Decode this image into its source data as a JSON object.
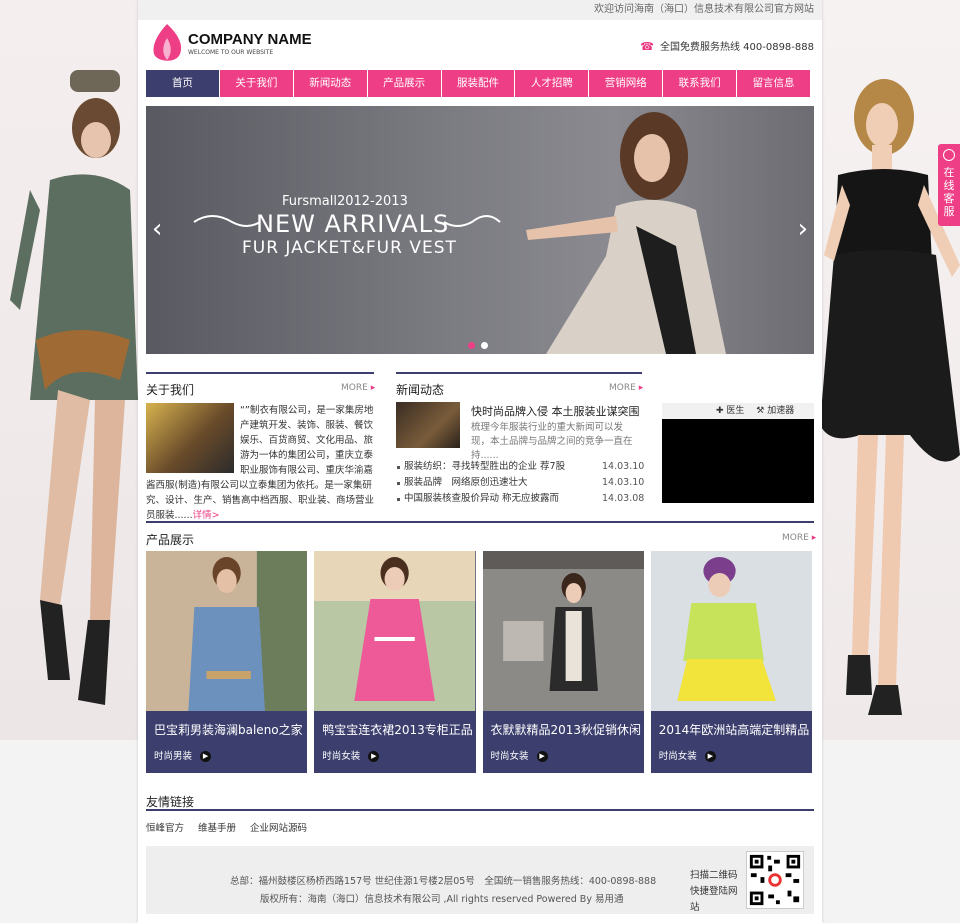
{
  "topbar": {
    "welcome": "欢迎访问海南（海口）信息技术有限公司官方网站"
  },
  "logo": {
    "name": "COMPANY NAME",
    "tagline": "WELCOME TO OUR WEBSITE"
  },
  "hotline": {
    "text": "全国免费服务热线 400-0898-888"
  },
  "nav": {
    "items": [
      "首页",
      "关于我们",
      "新闻动态",
      "产品展示",
      "服装配件",
      "人才招聘",
      "营销网络",
      "联系我们",
      "留言信息"
    ]
  },
  "banner": {
    "small": "Fursmall2012-2013",
    "big": "NEW ARRIVALS",
    "mid": "FUR JACKET&FUR VEST",
    "prev": "‹",
    "next": "›"
  },
  "about": {
    "title": "关于我们",
    "more": "MORE",
    "text": "“”制衣有限公司，是一家集房地产建筑开发、装饰、服装、餐饮娱乐、百货商贸、文化用品、旅游为一体的集团公司，重庆立泰职业服饰有限公司、重庆华渝嘉酱西服(制造)有限公司以立泰集团为依托。是一家集研究、设计、生产、销售高中档西服、职业装、商场营业员服装......",
    "detail": "详情>"
  },
  "news": {
    "title": "新闻动态",
    "more": "MORE",
    "headline": "快时尚品牌入侵 本土服装业谋突围",
    "desc": "梳理今年服装行业的重大新闻可以发现，本土品牌与品牌之间的竞争一直在持......",
    "list": [
      {
        "title": "服装纺织：寻找转型胜出的企业 荐7股",
        "date": "14.03.10"
      },
      {
        "title": "服装品牌　网络原创迅速壮大",
        "date": "14.03.10"
      },
      {
        "title": "中国服装核查股价异动 称无应披露而",
        "date": "14.03.08"
      }
    ]
  },
  "video": {
    "bar": "✚ 医生　 ⚒ 加速器"
  },
  "products": {
    "title": "产品展示",
    "more": "MORE",
    "items": [
      {
        "name": "巴宝莉男装海澜baleno之家",
        "category": "时尚男装"
      },
      {
        "name": "鸭宝宝连衣裙2013专柜正品",
        "category": "时尚女装"
      },
      {
        "name": "衣默默精品2013秋促销休闲",
        "category": "时尚女装"
      },
      {
        "name": "2014年欧洲站高端定制精品",
        "category": "时尚女装"
      }
    ]
  },
  "links": {
    "title": "友情链接",
    "items": [
      "恒峰官方",
      "维基手册",
      "企业网站源码"
    ]
  },
  "footer": {
    "line1": "总部：福州鼓楼区杨桥西路157号 世纪佳源1号楼2层05号　全国统一销售服务热线：400-0898-888",
    "line2": "版权所有：海南（海口）信息技术有限公司 ,All rights reserved Powered By 易用通",
    "qr_text": "扫描二维码快捷登陆网站"
  },
  "side_service": {
    "label": "在线客服"
  },
  "colors": {
    "accent": "#ee3e86",
    "navy": "#3c3f6e"
  }
}
